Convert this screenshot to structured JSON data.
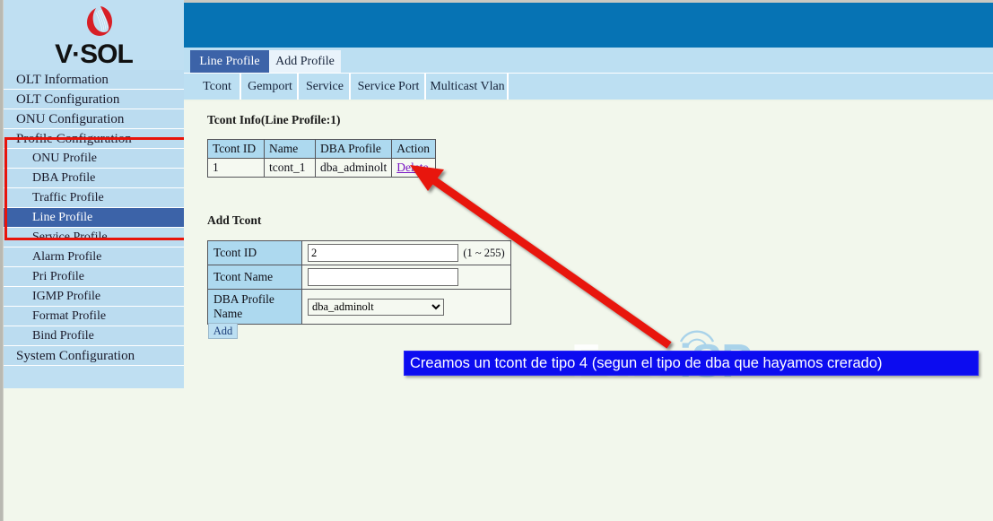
{
  "brand": {
    "name": "V·SOL",
    "logo_icon": "vsol-red-swoosh-logo"
  },
  "sidebar": {
    "items": [
      {
        "label": "OLT Information",
        "level": "top",
        "active": false
      },
      {
        "label": "OLT Configuration",
        "level": "top",
        "active": false
      },
      {
        "label": "ONU Configuration",
        "level": "top",
        "active": false
      },
      {
        "label": "Profile Configuration",
        "level": "top",
        "active": false
      },
      {
        "label": "ONU Profile",
        "level": "sub",
        "active": false
      },
      {
        "label": "DBA Profile",
        "level": "sub",
        "active": false
      },
      {
        "label": "Traffic Profile",
        "level": "sub",
        "active": false
      },
      {
        "label": "Line Profile",
        "level": "sub",
        "active": true
      },
      {
        "label": "Service Profile",
        "level": "sub",
        "active": false
      },
      {
        "label": "Alarm Profile",
        "level": "sub",
        "active": false
      },
      {
        "label": "Pri Profile",
        "level": "sub",
        "active": false
      },
      {
        "label": "IGMP Profile",
        "level": "sub",
        "active": false
      },
      {
        "label": "Format Profile",
        "level": "sub",
        "active": false
      },
      {
        "label": "Bind Profile",
        "level": "sub",
        "active": false
      },
      {
        "label": "System Configuration",
        "level": "top",
        "active": false
      }
    ]
  },
  "tabs": {
    "primary": [
      {
        "label": "Line Profile",
        "selected": true
      },
      {
        "label": "Add Profile",
        "selected": false
      }
    ],
    "secondary": [
      {
        "label": "Tcont",
        "selected": true
      },
      {
        "label": "Gemport",
        "selected": false
      },
      {
        "label": "Service",
        "selected": false
      },
      {
        "label": "Service Port",
        "selected": false
      },
      {
        "label": "Multicast Vlan",
        "selected": false
      }
    ]
  },
  "main": {
    "tcont_info": {
      "title": "Tcont Info(Line Profile:1)",
      "columns": [
        "Tcont ID",
        "Name",
        "DBA Profile",
        "Action"
      ],
      "rows": [
        {
          "tcont_id": "1",
          "name": "tcont_1",
          "dba_profile": "dba_adminolt",
          "action": "Delete"
        }
      ]
    },
    "add_tcont": {
      "title": "Add Tcont",
      "fields": {
        "tcont_id": {
          "label": "Tcont ID",
          "value": "2",
          "placeholder": "",
          "hint": "(1 ~ 255)"
        },
        "tcont_name": {
          "label": "Tcont Name",
          "value": "",
          "placeholder": ""
        },
        "dba_profile_name": {
          "label": "DBA Profile Name",
          "value": "dba_adminolt",
          "options": [
            "dba_adminolt"
          ]
        }
      },
      "submit_label": "Add"
    }
  },
  "watermark": {
    "part1": "Foro",
    "part2": "iSP"
  },
  "annotation": {
    "callout_text": "Creamos un tcont de tipo 4 (segun el tipo de dba que hayamos crerado)",
    "arrow_icon": "red-arrow-pointing-up-left",
    "highlight_icon": "red-rectangle-highlight"
  },
  "colors": {
    "header_blue": "#0673b4",
    "sidebar_blue": "#bbdcf0",
    "active_nav": "#3c63a8",
    "table_header": "#add9ef",
    "content_bg": "#f2f7ec",
    "annotation_red": "#e8140b",
    "callout_blue": "#0c0cf0",
    "link_purple": "#7b18c4"
  }
}
